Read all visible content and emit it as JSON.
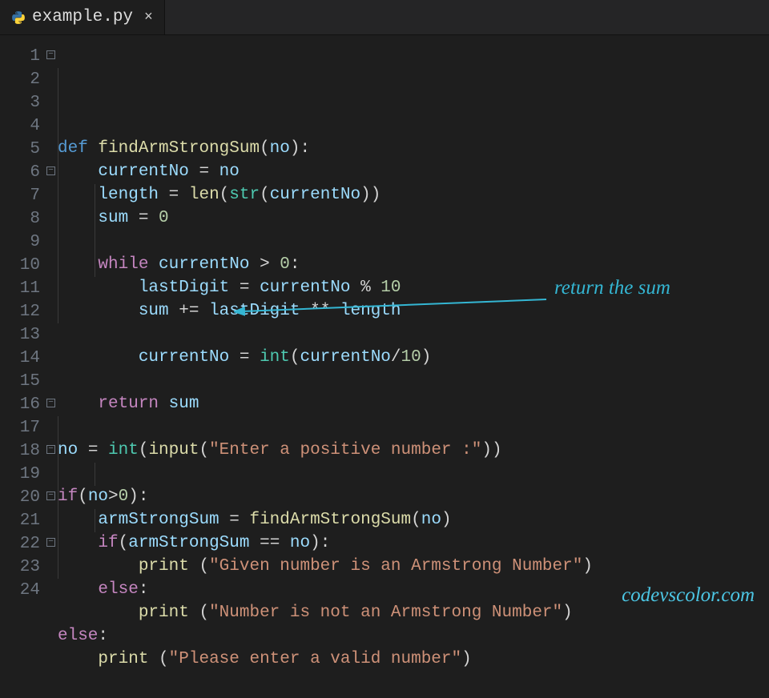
{
  "tab": {
    "filename": "example.py",
    "lang_icon": "python-icon"
  },
  "annotation": {
    "text": "return the sum"
  },
  "watermark": "codevscolor.com",
  "line_count": 24,
  "fold_lines": [
    1,
    6,
    16,
    18,
    20,
    22
  ],
  "code": {
    "1": [
      [
        "kw2",
        "def "
      ],
      [
        "fn",
        "findArmStrongSum"
      ],
      [
        "pun",
        "("
      ],
      [
        "var",
        "no"
      ],
      [
        "pun",
        "):"
      ]
    ],
    "2": [
      [
        "pun",
        "    "
      ],
      [
        "var",
        "currentNo"
      ],
      [
        "pun",
        " = "
      ],
      [
        "var",
        "no"
      ]
    ],
    "3": [
      [
        "pun",
        "    "
      ],
      [
        "var",
        "length"
      ],
      [
        "pun",
        " = "
      ],
      [
        "fn",
        "len"
      ],
      [
        "pun",
        "("
      ],
      [
        "call",
        "str"
      ],
      [
        "pun",
        "("
      ],
      [
        "var",
        "currentNo"
      ],
      [
        "pun",
        "))"
      ]
    ],
    "4": [
      [
        "pun",
        "    "
      ],
      [
        "var",
        "sum"
      ],
      [
        "pun",
        " = "
      ],
      [
        "num",
        "0"
      ]
    ],
    "5": [
      [
        "pun",
        ""
      ]
    ],
    "6": [
      [
        "pun",
        "    "
      ],
      [
        "kw",
        "while "
      ],
      [
        "var",
        "currentNo"
      ],
      [
        "pun",
        " > "
      ],
      [
        "num",
        "0"
      ],
      [
        "pun",
        ":"
      ]
    ],
    "7": [
      [
        "pun",
        "        "
      ],
      [
        "var",
        "lastDigit"
      ],
      [
        "pun",
        " = "
      ],
      [
        "var",
        "currentNo"
      ],
      [
        "pun",
        " % "
      ],
      [
        "num",
        "10"
      ]
    ],
    "8": [
      [
        "pun",
        "        "
      ],
      [
        "var",
        "sum"
      ],
      [
        "pun",
        " += "
      ],
      [
        "var",
        "lastDigit"
      ],
      [
        "pun",
        " ** "
      ],
      [
        "var",
        "length"
      ]
    ],
    "9": [
      [
        "pun",
        ""
      ]
    ],
    "10": [
      [
        "pun",
        "        "
      ],
      [
        "var",
        "currentNo"
      ],
      [
        "pun",
        " = "
      ],
      [
        "call",
        "int"
      ],
      [
        "pun",
        "("
      ],
      [
        "var",
        "currentNo"
      ],
      [
        "pun",
        "/"
      ],
      [
        "num",
        "10"
      ],
      [
        "pun",
        ")"
      ]
    ],
    "11": [
      [
        "pun",
        ""
      ]
    ],
    "12": [
      [
        "pun",
        "    "
      ],
      [
        "kw",
        "return "
      ],
      [
        "var",
        "sum"
      ]
    ],
    "13": [
      [
        "pun",
        ""
      ]
    ],
    "14": [
      [
        "var",
        "no"
      ],
      [
        "pun",
        " = "
      ],
      [
        "call",
        "int"
      ],
      [
        "pun",
        "("
      ],
      [
        "fn",
        "input"
      ],
      [
        "pun",
        "("
      ],
      [
        "str",
        "\"Enter a positive number :\""
      ],
      [
        "pun",
        "))"
      ]
    ],
    "15": [
      [
        "pun",
        ""
      ]
    ],
    "16": [
      [
        "kw",
        "if"
      ],
      [
        "pun",
        "("
      ],
      [
        "var",
        "no"
      ],
      [
        "pun",
        ">"
      ],
      [
        "num",
        "0"
      ],
      [
        "pun",
        "):"
      ]
    ],
    "17": [
      [
        "pun",
        "    "
      ],
      [
        "var",
        "armStrongSum"
      ],
      [
        "pun",
        " = "
      ],
      [
        "fn",
        "findArmStrongSum"
      ],
      [
        "pun",
        "("
      ],
      [
        "var",
        "no"
      ],
      [
        "pun",
        ")"
      ]
    ],
    "18": [
      [
        "pun",
        "    "
      ],
      [
        "kw",
        "if"
      ],
      [
        "pun",
        "("
      ],
      [
        "var",
        "armStrongSum"
      ],
      [
        "pun",
        " == "
      ],
      [
        "var",
        "no"
      ],
      [
        "pun",
        "):"
      ]
    ],
    "19": [
      [
        "pun",
        "        "
      ],
      [
        "fn",
        "print"
      ],
      [
        "pun",
        " ("
      ],
      [
        "str",
        "\"Given number is an Armstrong Number\""
      ],
      [
        "pun",
        ")"
      ]
    ],
    "20": [
      [
        "pun",
        "    "
      ],
      [
        "kw",
        "else"
      ],
      [
        "pun",
        ":"
      ]
    ],
    "21": [
      [
        "pun",
        "        "
      ],
      [
        "fn",
        "print"
      ],
      [
        "pun",
        " ("
      ],
      [
        "str",
        "\"Number is not an Armstrong Number\""
      ],
      [
        "pun",
        ")"
      ]
    ],
    "22": [
      [
        "kw",
        "else"
      ],
      [
        "pun",
        ":"
      ]
    ],
    "23": [
      [
        "pun",
        "    "
      ],
      [
        "fn",
        "print"
      ],
      [
        "pun",
        " ("
      ],
      [
        "str",
        "\"Please enter a valid number\""
      ],
      [
        "pun",
        ")"
      ]
    ],
    "24": [
      [
        "pun",
        ""
      ]
    ]
  }
}
